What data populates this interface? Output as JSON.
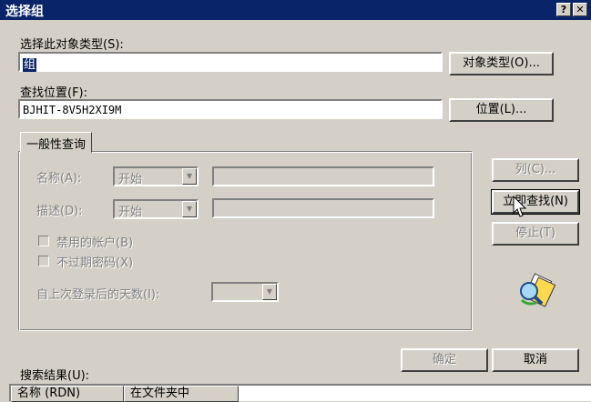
{
  "window": {
    "title": "选择组",
    "help_label": "?",
    "close_label": "✕"
  },
  "object_type": {
    "label": "选择此对象类型(S):",
    "value": "组",
    "button_label": "对象类型(O)..."
  },
  "location": {
    "label": "查找位置(F):",
    "value": "BJHIT-8V5H2XI9M",
    "button_label": "位置(L)..."
  },
  "query": {
    "tab_label": "一般性查询",
    "name": {
      "label": "名称(A):",
      "mode": "开始"
    },
    "description": {
      "label": "描述(D):",
      "mode": "开始"
    },
    "disabled_accounts": {
      "label": "禁用的帐户(B)",
      "checked": false
    },
    "non_expiring_pwd": {
      "label": "不过期密码(X)",
      "checked": false
    },
    "days_since_logon": {
      "label": "自上次登录后的天数(I):"
    }
  },
  "actions": {
    "columns_label": "列(C)...",
    "find_now_label": "立即查找(N)",
    "stop_label": "停止(T)"
  },
  "footer": {
    "ok_label": "确定",
    "cancel_label": "取消"
  },
  "results": {
    "label": "搜索结果(U):",
    "columns": [
      "名称 (RDN)",
      "在文件夹中"
    ]
  }
}
